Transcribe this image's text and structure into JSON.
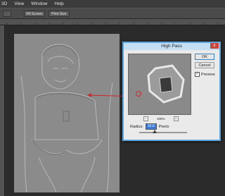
{
  "menu": [
    "3D",
    "View",
    "Window",
    "Help"
  ],
  "options": {
    "fill_screen": "Fill Screen",
    "print_size": "Print Size"
  },
  "dialog": {
    "title": "High Pass",
    "close": "x",
    "ok": "OK",
    "cancel": "Cancel",
    "preview_label": "Preview",
    "preview_checked": "✓",
    "zoom": "100%",
    "zoom_out": "−",
    "zoom_in": "+",
    "radius_label": "Radius:",
    "radius_value": "10.0",
    "radius_unit": "Pixels"
  },
  "colors": {
    "dialog_border": "#5fa6de",
    "arrow": "#d0262b",
    "menubar": "#3c3c3c"
  }
}
